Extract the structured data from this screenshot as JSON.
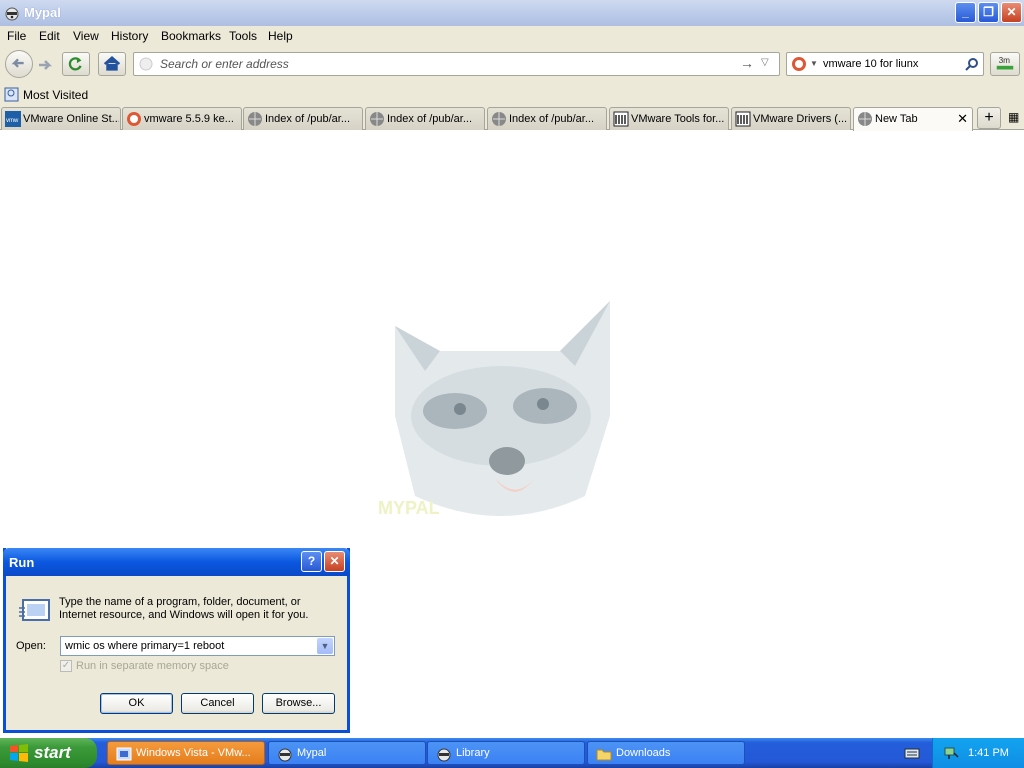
{
  "window": {
    "title": "Mypal"
  },
  "menu": [
    "File",
    "Edit",
    "View",
    "History",
    "Bookmarks",
    "Tools",
    "Help"
  ],
  "nav": {
    "url_placeholder": "Search or enter address",
    "search_value": "vmware 10 for liunx"
  },
  "bookmarks": {
    "most_visited": "Most Visited"
  },
  "tabs": [
    {
      "label": "VMware Online St...",
      "icon": "vmware-icon"
    },
    {
      "label": "vmware 5.5.9 ke...",
      "icon": "duckduckgo-icon"
    },
    {
      "label": "Index of /pub/ar...",
      "icon": "globe-icon"
    },
    {
      "label": "Index of /pub/ar...",
      "icon": "globe-icon"
    },
    {
      "label": "Index of /pub/ar...",
      "icon": "globe-icon"
    },
    {
      "label": "VMware Tools for...",
      "icon": "archive-icon"
    },
    {
      "label": "VMware Drivers (...",
      "icon": "archive-icon"
    },
    {
      "label": "New Tab",
      "icon": "globe-icon",
      "active": true
    }
  ],
  "content": {
    "logo_text": "MYPAL"
  },
  "run_dialog": {
    "title": "Run",
    "help_button": "?",
    "description": "Type the name of a program, folder, document, or Internet resource, and Windows will open it for you.",
    "open_label": "Open:",
    "command": "wmic os where primary=1 reboot",
    "checkbox_label": "Run in separate memory space",
    "ok": "OK",
    "cancel": "Cancel",
    "browse": "Browse..."
  },
  "taskbar": {
    "start": "start",
    "tasks": [
      {
        "label": "Windows Vista - VMw...",
        "active": true
      },
      {
        "label": "Mypal"
      },
      {
        "label": "Library"
      },
      {
        "label": "Downloads"
      }
    ],
    "clock": "1:41 PM"
  },
  "colors": {
    "accent": "#0a4fd8",
    "start_green": "#3c9a3a",
    "taskbar_blue": "#245edb"
  }
}
